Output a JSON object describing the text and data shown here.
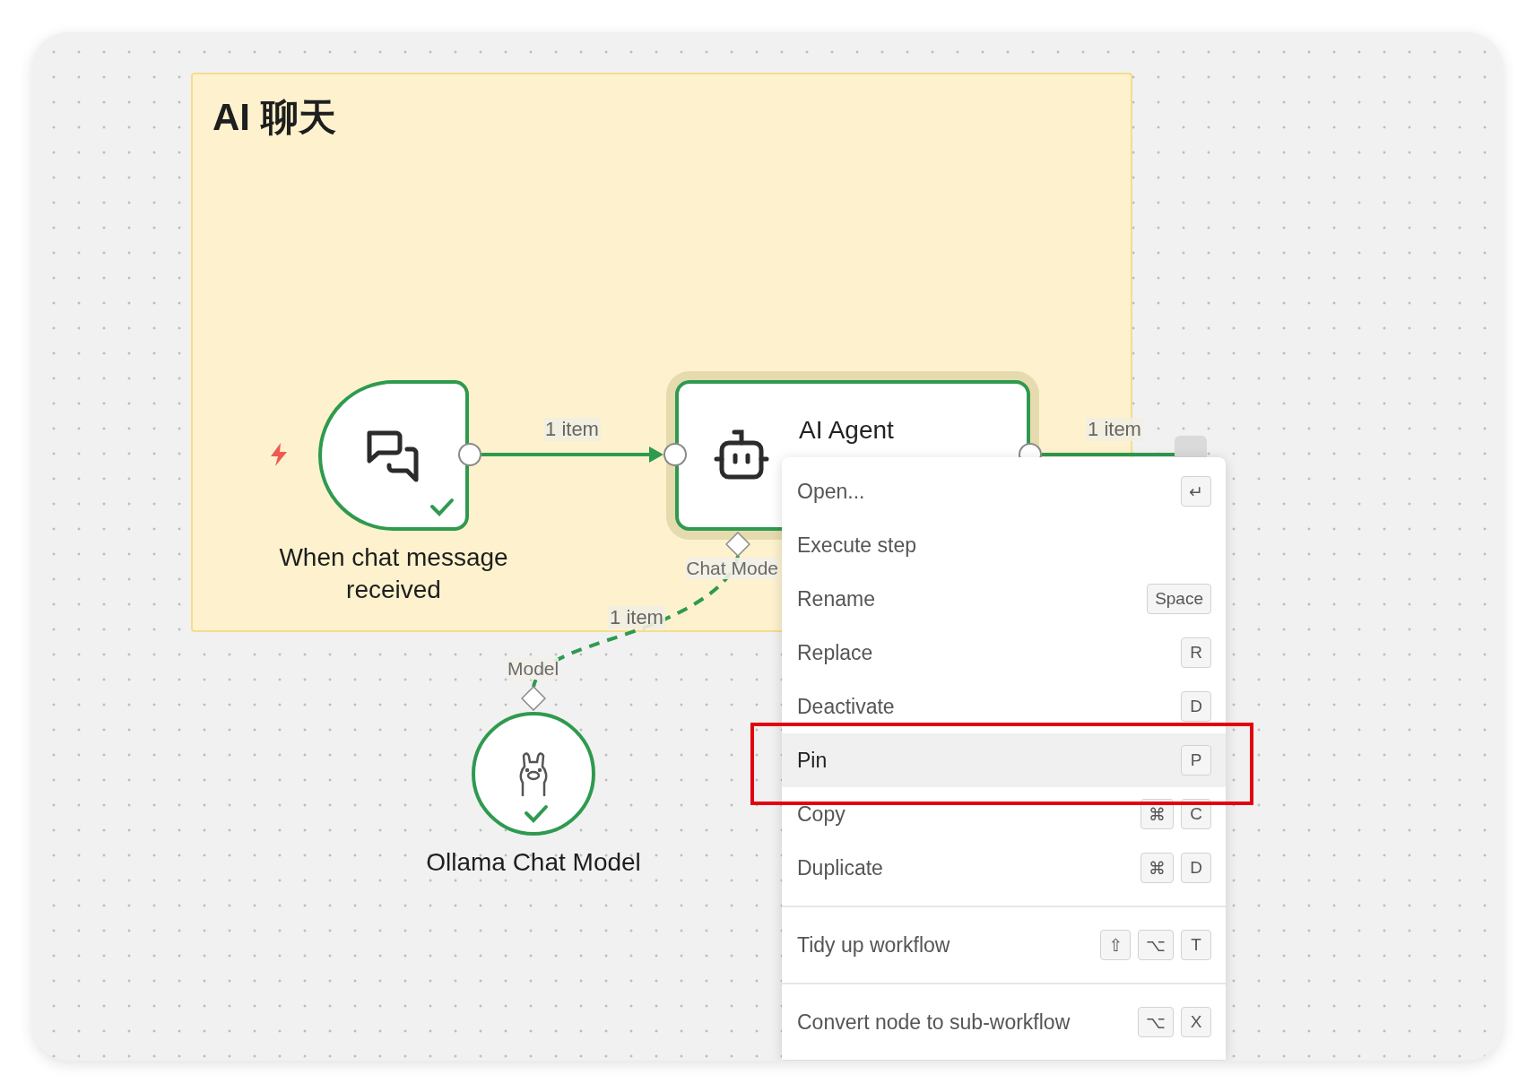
{
  "group": {
    "title": "AI 聊天"
  },
  "nodes": [
    {
      "kind": "trigger",
      "label": "When chat message received",
      "success": true,
      "selected": false
    },
    {
      "kind": "agent",
      "label": "AI Agent",
      "success": true,
      "selected": true
    },
    {
      "kind": "model",
      "label": "Ollama Chat Model",
      "success": true,
      "selected": false
    }
  ],
  "connections": [
    {
      "kind": "main",
      "label": "1 item"
    },
    {
      "kind": "main",
      "label": "1 item"
    },
    {
      "kind": "sub",
      "label": "1 item"
    }
  ],
  "ports": [
    {
      "label": "Chat Mode"
    },
    {
      "label": "Model"
    }
  ],
  "context_menu": {
    "sections": [
      {
        "items": [
          {
            "label": "Open...",
            "keys": [
              "↵"
            ],
            "selected": false
          },
          {
            "label": "Execute step",
            "selected": false
          },
          {
            "label": "Rename",
            "keys": [
              "Space"
            ],
            "selected": false
          },
          {
            "label": "Replace",
            "keys": [
              "R"
            ],
            "selected": false
          },
          {
            "label": "Deactivate",
            "keys": [
              "D"
            ],
            "selected": false
          },
          {
            "label": "Pin",
            "keys": [
              "P"
            ],
            "selected": true
          },
          {
            "label": "Copy",
            "keys": [
              "⌘",
              "C"
            ],
            "selected": false
          },
          {
            "label": "Duplicate",
            "keys": [
              "⌘",
              "D"
            ],
            "selected": false
          }
        ]
      },
      {
        "items": [
          {
            "label": "Tidy up workflow",
            "keys": [
              "⇧",
              "⌥",
              "T"
            ],
            "selected": false
          }
        ]
      },
      {
        "items": [
          {
            "label": "Convert node to sub-workflow",
            "keys": [
              "⌥",
              "X"
            ],
            "selected": false
          }
        ]
      }
    ]
  }
}
